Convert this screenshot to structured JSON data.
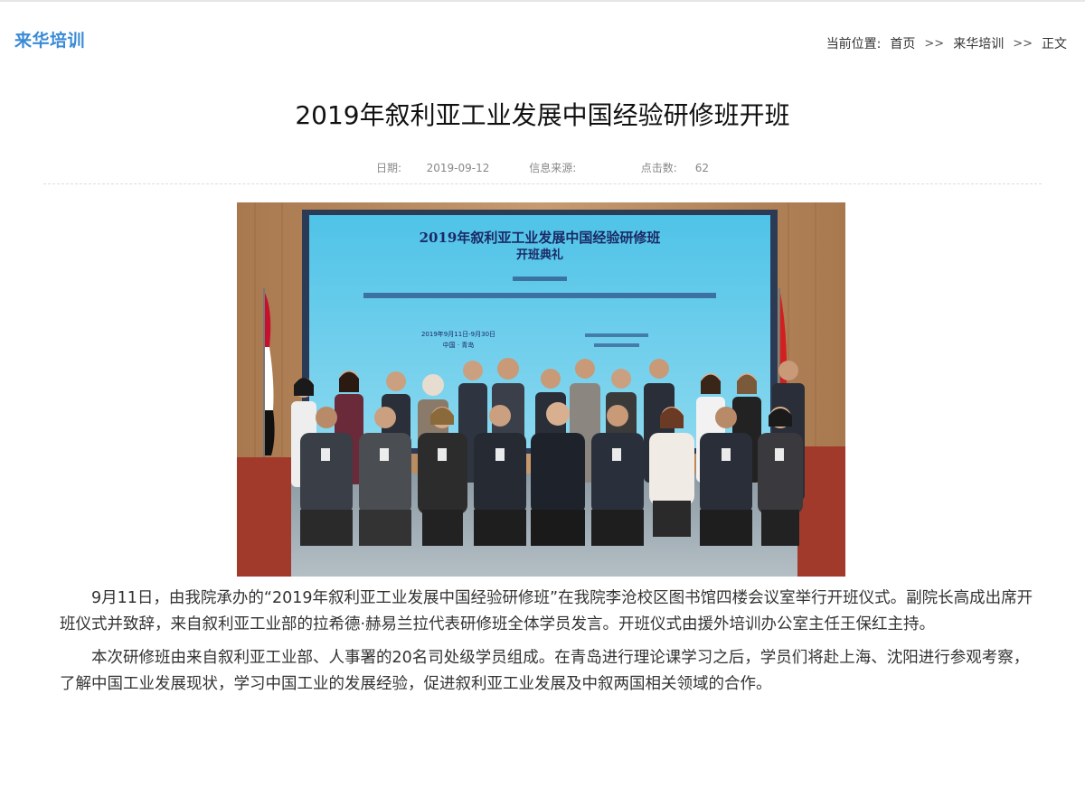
{
  "header": {
    "section_title": "来华培训",
    "breadcrumb": {
      "prefix": "当前位置:",
      "items": [
        "首页",
        "来华培训",
        "正文"
      ],
      "separator": ">>"
    }
  },
  "article": {
    "title": "2019年叙利亚工业发展中国经验研修班开班",
    "meta": {
      "date_label": "日期:",
      "date": "2019-09-12",
      "source_label": "信息来源:",
      "source": "",
      "clicks_label": "点击数:",
      "clicks": "62"
    },
    "photo": {
      "screen_title_line1": "2019年叙利亚工业发展中国经验研修班",
      "screen_title_line2": "开班典礼",
      "screen_date_left": "2019年9月11日-9月30日",
      "screen_place_left": "中国 · 青岛"
    },
    "paragraphs": [
      "9月11日，由我院承办的“2019年叙利亚工业发展中国经验研修班”在我院李沧校区图书馆四楼会议室举行开班仪式。副院长高成出席开班仪式并致辞，来自叙利亚工业部的拉希德·赫易兰拉代表研修班全体学员发言。开班仪式由援外培训办公室主任王保红主持。",
      "本次研修班由来自叙利亚工业部、人事署的20名司处级学员组成。在青岛进行理论课学习之后，学员们将赴上海、沈阳进行参观考察，了解中国工业发展现状，学习中国工业的发展经验，促进叙利亚工业发展及中叙两国相关领域的合作。"
    ]
  }
}
